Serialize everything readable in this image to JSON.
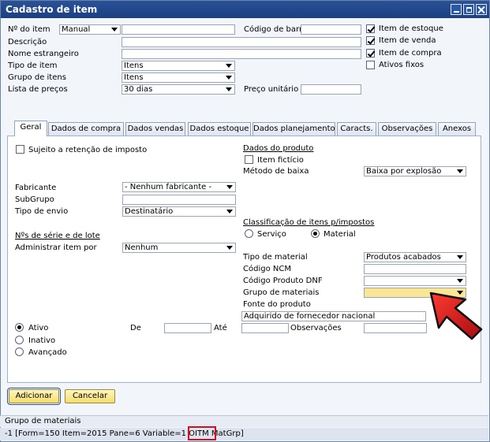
{
  "window": {
    "title": "Cadastro de item"
  },
  "header": {
    "item_number_label": "Nº do item",
    "item_number_series": "Manual",
    "barcode_label": "Código de barra",
    "description_label": "Descrição",
    "foreign_name_label": "Nome estrangeiro",
    "item_type_label": "Tipo de item",
    "item_type_value": "Itens",
    "item_group_label": "Grupo de itens",
    "item_group_value": "Itens",
    "price_list_label": "Lista de preços",
    "price_list_value": "30 dias",
    "unit_price_label": "Preço unitário",
    "inventory_item_label": "Item de estoque",
    "sales_item_label": "Item de venda",
    "purchase_item_label": "Item de compra",
    "fixed_assets_label": "Ativos fixos"
  },
  "tabs": [
    {
      "label": "Geral"
    },
    {
      "label": "Dados de compra"
    },
    {
      "label": "Dados vendas"
    },
    {
      "label": "Dados estoque"
    },
    {
      "label": "Dados planejamento"
    },
    {
      "label": "Caracts."
    },
    {
      "label": "Observações"
    },
    {
      "label": "Anexos"
    }
  ],
  "general": {
    "withholding_tax_label": "Sujeito a retenção de imposto",
    "manufacturer_label": "Fabricante",
    "manufacturer_value": "- Nenhum fabricante -",
    "subgroup_label": "SubGrupo",
    "shipping_type_label": "Tipo de envio",
    "shipping_type_value": "Destinatário",
    "serial_batch_label": "Nºs de série e de lote",
    "manage_item_by_label": "Administrar item por",
    "manage_item_by_value": "Nenhum",
    "product_data_label": "Dados do produto",
    "phantom_item_label": "Item fictício",
    "issue_method_label": "Método de baixa",
    "issue_method_value": "Baixa por explosão",
    "tax_classification_label": "Classificação de itens p/impostos",
    "service_label": "Serviço",
    "material_label": "Material",
    "material_type_label": "Tipo de material",
    "material_type_value": "Produtos acabados",
    "ncm_code_label": "Código NCM",
    "dnf_code_label": "Código Produto DNF",
    "material_group_label": "Grupo de materiais",
    "product_source_label": "Fonte do produto",
    "product_source_value": "Adquirido de fornecedor nacional",
    "active_label": "Ativo",
    "inactive_label": "Inativo",
    "advanced_label": "Avançado",
    "from_label": "De",
    "to_label": "Até",
    "remarks_label": "Observações"
  },
  "buttons": {
    "add": "Adicionar",
    "cancel": "Cancelar"
  },
  "status": {
    "field_name": "Grupo de materiais",
    "info_prefix": "-1 [Form=150 Item=2015 Pane=6 Variable=1 OITM ",
    "info_field": "MatGrp",
    "info_suffix": "]"
  },
  "colors": {
    "titlebar": "#1c3f80",
    "highlight_field": "#fbe696",
    "arrow": "#d1121b",
    "button": "#f5dd6a"
  }
}
